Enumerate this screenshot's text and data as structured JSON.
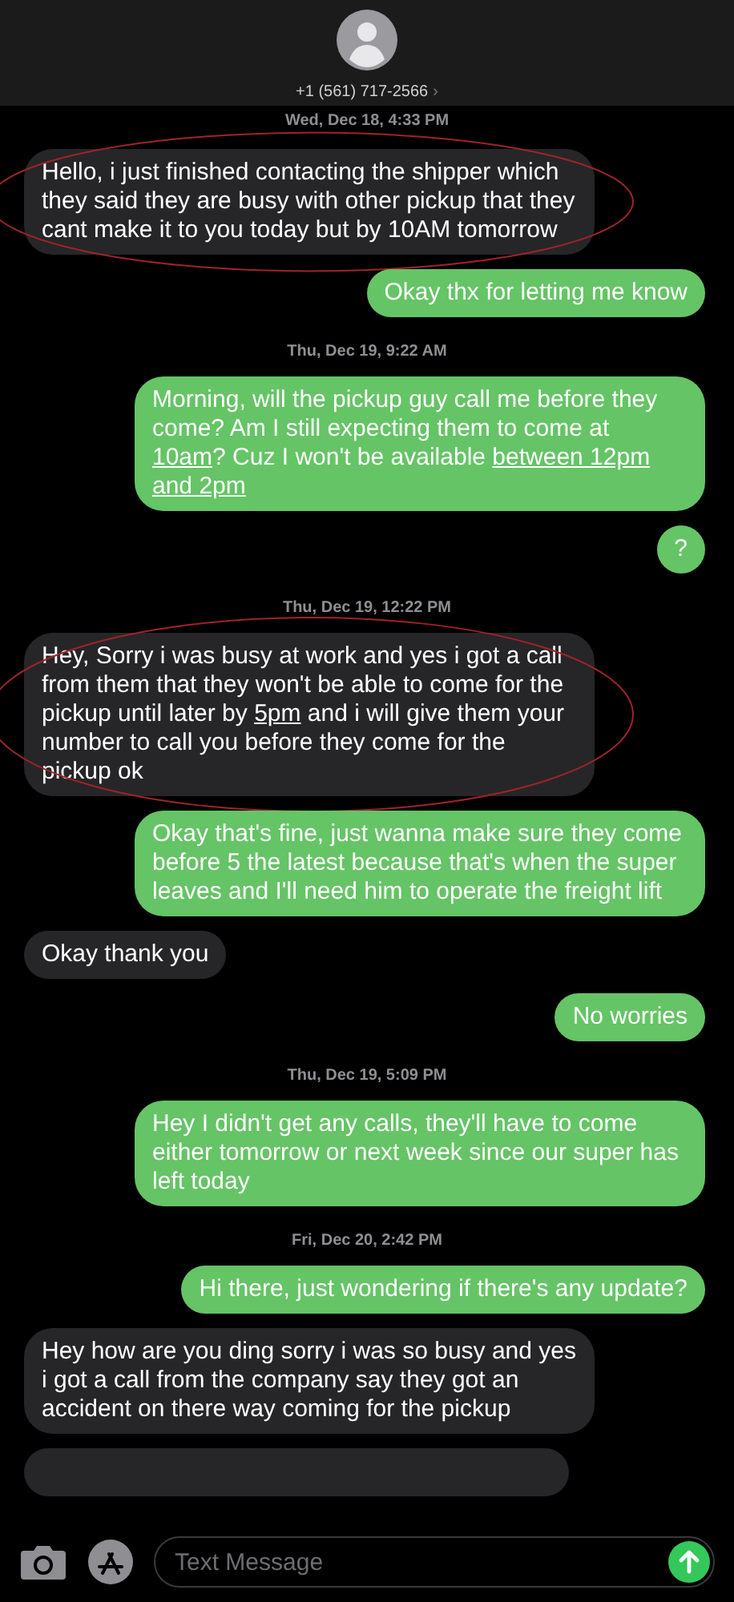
{
  "contact": {
    "number": "+1 (561) 717-2566",
    "chevron": "›"
  },
  "thread": [
    {
      "kind": "timestamp",
      "text": "Wed, Dec 18, 4:33 PM"
    },
    {
      "kind": "received",
      "circled": true,
      "segments": [
        {
          "text": "Hello, i just finished contacting the shipper which they said they are busy with other pickup that they cant make it to you today but  by 10AM tomorrow",
          "underline": false
        }
      ]
    },
    {
      "kind": "sent",
      "circled": false,
      "segments": [
        {
          "text": "Okay thx for letting me know",
          "underline": false
        }
      ]
    },
    {
      "kind": "timestamp",
      "text": "Thu, Dec 19, 9:22 AM"
    },
    {
      "kind": "sent",
      "circled": false,
      "segments": [
        {
          "text": "Morning, will the pickup guy call me before they come? Am I still expecting them to come at ",
          "underline": false
        },
        {
          "text": "10am",
          "underline": true
        },
        {
          "text": "? Cuz I won't be available ",
          "underline": false
        },
        {
          "text": "between 12pm and 2pm",
          "underline": true
        }
      ]
    },
    {
      "kind": "sent",
      "circled": false,
      "segments": [
        {
          "text": "?",
          "underline": false
        }
      ]
    },
    {
      "kind": "timestamp",
      "text": "Thu, Dec 19, 12:22 PM"
    },
    {
      "kind": "received",
      "circled": true,
      "segments": [
        {
          "text": "Hey, Sorry i was busy at work and yes i got a call from them that they won't be able to come for the pickup until later by ",
          "underline": false
        },
        {
          "text": "5pm",
          "underline": true
        },
        {
          "text": " and i will give them your number to call you before they come for the pickup ok",
          "underline": false
        }
      ]
    },
    {
      "kind": "sent",
      "circled": false,
      "segments": [
        {
          "text": "Okay that's fine, just wanna make sure they come before 5 the latest because that's when the super leaves and I'll need him to operate the freight lift",
          "underline": false
        }
      ]
    },
    {
      "kind": "received",
      "circled": false,
      "segments": [
        {
          "text": "Okay thank you",
          "underline": false
        }
      ]
    },
    {
      "kind": "sent",
      "circled": false,
      "segments": [
        {
          "text": "No worries",
          "underline": false
        }
      ]
    },
    {
      "kind": "timestamp",
      "text": "Thu, Dec 19, 5:09 PM"
    },
    {
      "kind": "sent",
      "circled": false,
      "segments": [
        {
          "text": "Hey I didn't get any calls, they'll have to come either tomorrow or next week since our super has left today",
          "underline": false
        }
      ]
    },
    {
      "kind": "timestamp",
      "text": "Fri, Dec 20, 2:42 PM"
    },
    {
      "kind": "sent",
      "circled": false,
      "segments": [
        {
          "text": "Hi there, just wondering if there's any update?",
          "underline": false
        }
      ]
    },
    {
      "kind": "received",
      "circled": false,
      "segments": [
        {
          "text": "Hey  how are you ding sorry i was so busy and yes i got a call from the company say they got an accident on there way coming for the pickup",
          "underline": false
        }
      ]
    },
    {
      "kind": "partial"
    }
  ],
  "composer": {
    "placeholder": "Text Message"
  }
}
